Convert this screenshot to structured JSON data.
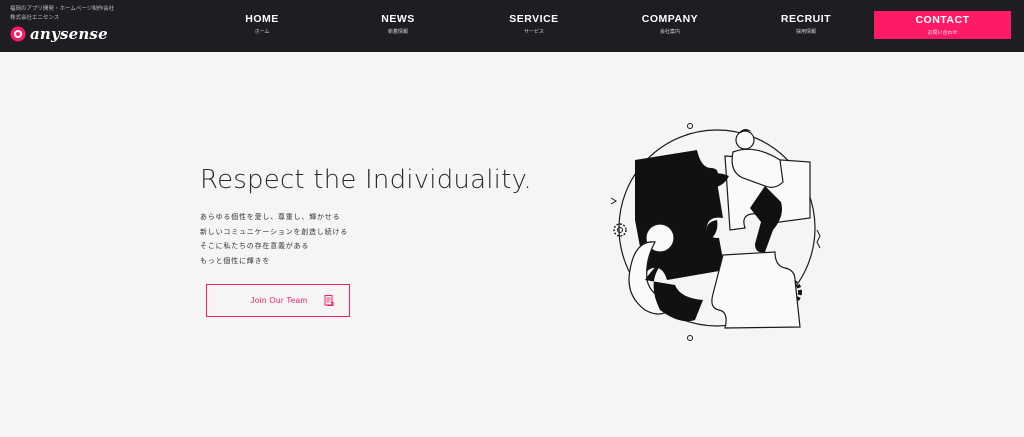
{
  "brand": {
    "tagline_line1": "福岡のアプリ開発・ホームページ制作会社",
    "tagline_line2": "株式会社エニセンス",
    "name": "anysense",
    "logo_icon": "anysense-logo-icon",
    "accent_color": "#ff1a66"
  },
  "nav": {
    "items": [
      {
        "en": "HOME",
        "ja": "ホーム"
      },
      {
        "en": "NEWS",
        "ja": "新着情報"
      },
      {
        "en": "SERVICE",
        "ja": "サービス"
      },
      {
        "en": "COMPANY",
        "ja": "会社案内"
      },
      {
        "en": "RECRUIT",
        "ja": "採用情報"
      }
    ],
    "contact": {
      "en": "CONTACT",
      "ja": "お問い合わせ"
    }
  },
  "hero": {
    "headline": "Respect the Individuality.",
    "lead": [
      "あらゆる個性を愛し、尊重し、輝かせる",
      "新しいコミュニケーションを創造し続ける",
      "そこに私たちの存在意義がある",
      "もっと個性に輝きを"
    ],
    "cta_label": "Join Our Team",
    "cta_icon": "document-icon",
    "illustration": "puzzle-teamwork-illustration"
  },
  "colors": {
    "header_bg": "#1e1e22",
    "page_bg": "#f5f5f5",
    "accent": "#ff1a66"
  }
}
